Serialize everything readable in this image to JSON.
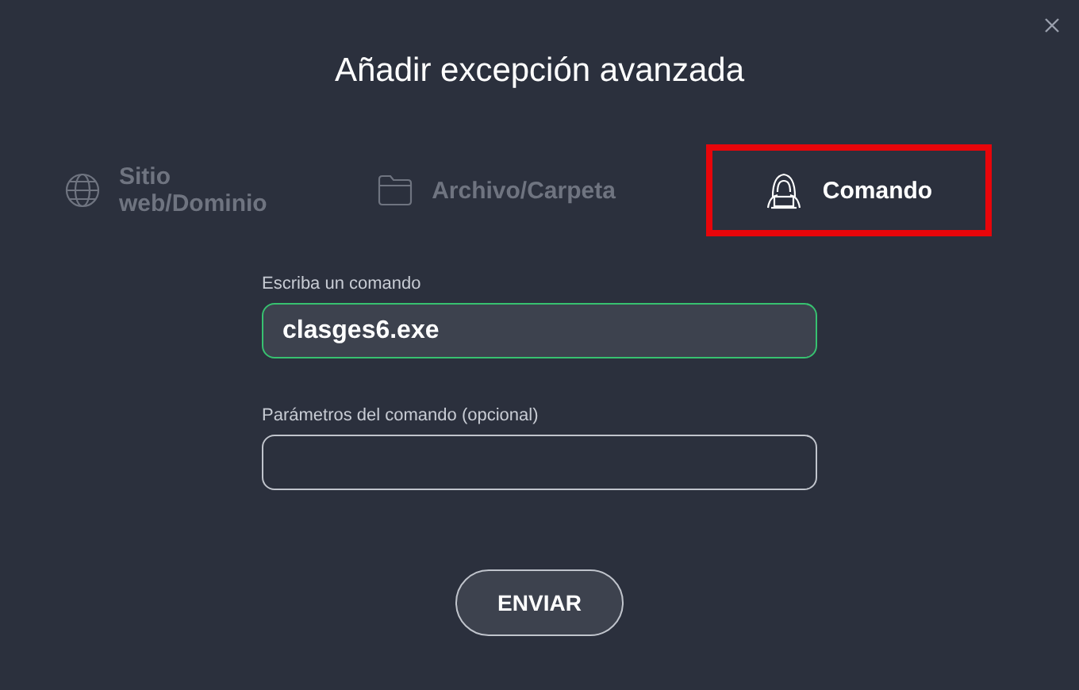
{
  "dialog": {
    "title": "Añadir excepción avanzada"
  },
  "tabs": [
    {
      "label": "Sitio web/Dominio",
      "kind": "globe",
      "selected": false,
      "highlighted": false
    },
    {
      "label": "Archivo/Carpeta",
      "kind": "folder",
      "selected": false,
      "highlighted": false
    },
    {
      "label": "Comando",
      "kind": "hacker",
      "selected": true,
      "highlighted": true
    }
  ],
  "fields": [
    {
      "label": "Escriba un comando",
      "value": "clasges6.exe",
      "focused": true
    },
    {
      "label": "Parámetros del comando (opcional)",
      "focused": false
    }
  ],
  "submit_button": "ENVIAR"
}
